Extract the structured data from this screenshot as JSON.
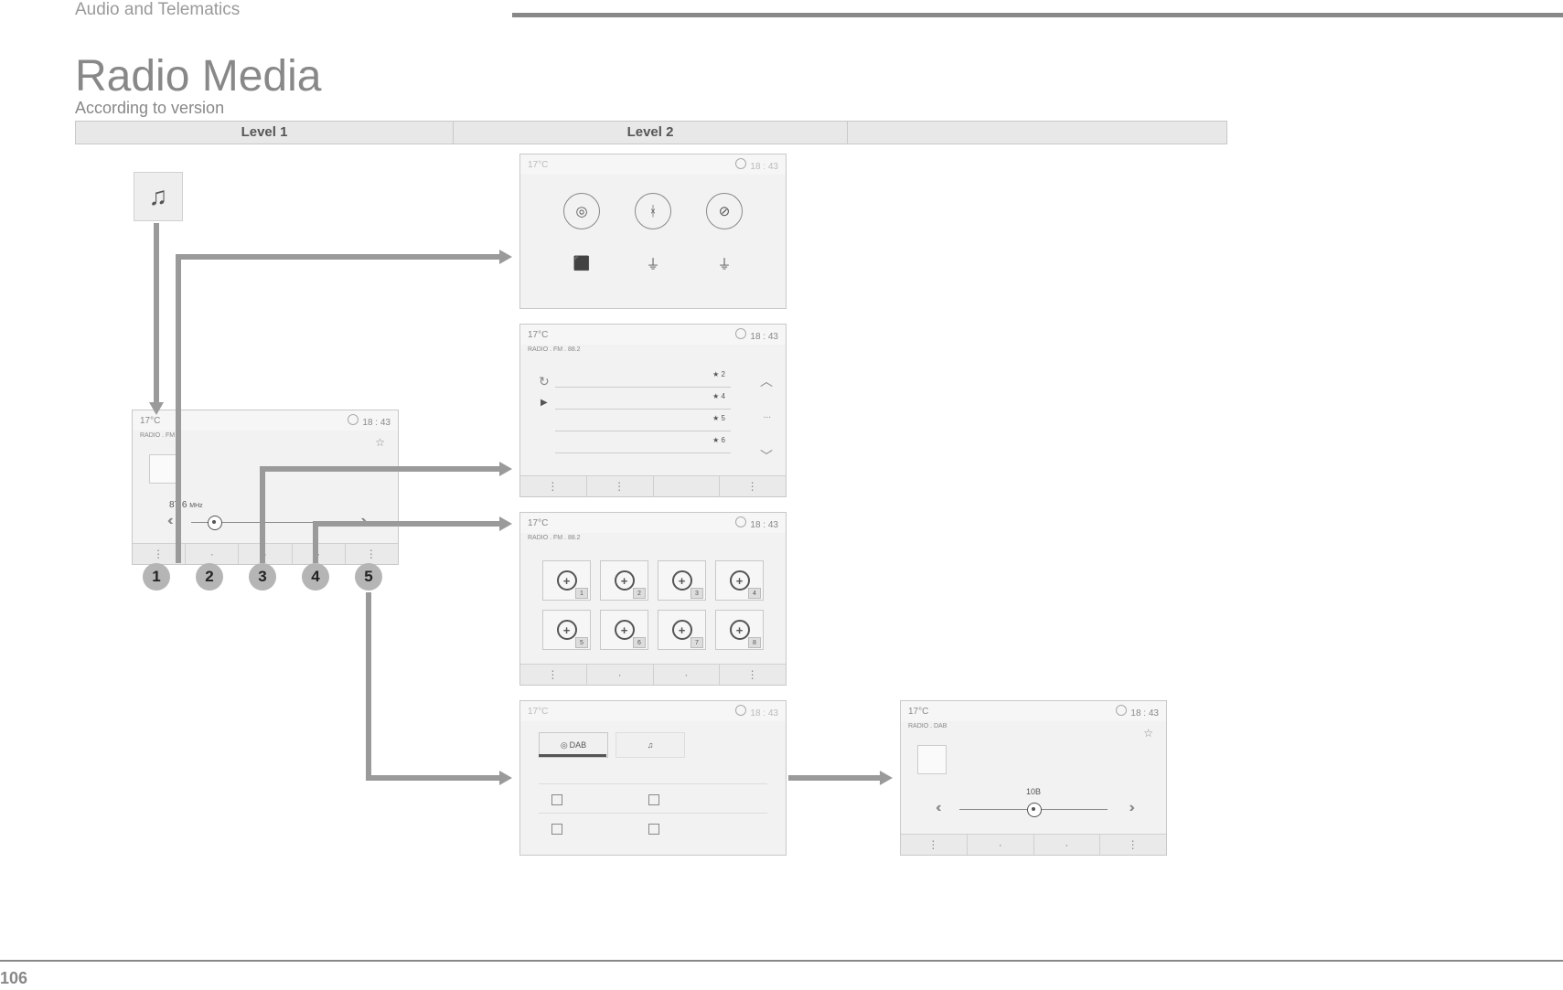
{
  "header": {
    "section": "Audio and Telematics",
    "title": "Radio Media",
    "subtitle": "According to version",
    "page": "106"
  },
  "levels": {
    "l1": "Level 1",
    "l2": "Level 2",
    "l3": ""
  },
  "status": {
    "temp": "17°C",
    "time": "18 : 43"
  },
  "scr1": {
    "sub": "RADIO . FM",
    "freq": "87.6",
    "unit": "MHz"
  },
  "markers": {
    "b1": "1",
    "b2": "2",
    "b3": "3",
    "b4": "4",
    "b5": "5"
  },
  "scr_list": {
    "sub": "RADIO . FM . 88.2",
    "rows": {
      "r1": "2",
      "r2": "4",
      "r3": "5",
      "r4": "6"
    },
    "more": "..."
  },
  "scr_presets": {
    "sub": "RADIO . FM . 88.2",
    "nums": {
      "n1": "1",
      "n2": "2",
      "n3": "3",
      "n4": "4",
      "n5": "5",
      "n6": "6",
      "n7": "7",
      "n8": "8"
    }
  },
  "scr_band": {
    "tab1": "DAB"
  },
  "scr_dab": {
    "sub": "RADIO . DAB",
    "chan": "10B"
  }
}
